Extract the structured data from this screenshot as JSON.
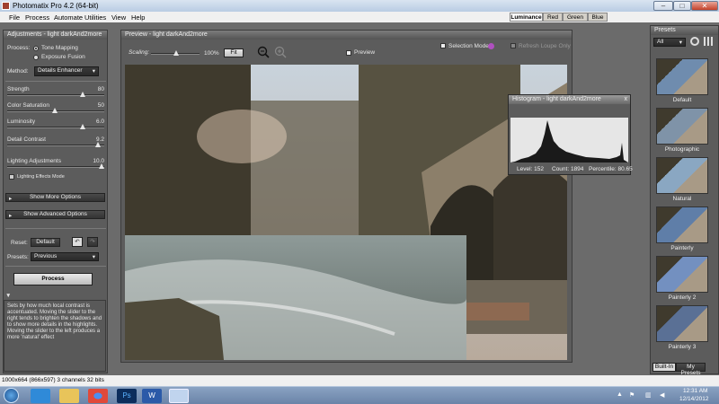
{
  "window": {
    "title": "Photomatix Pro 4.2 (64-bit)"
  },
  "menu": [
    "File",
    "Process",
    "Automate",
    "Utilities",
    "View",
    "Help"
  ],
  "adjustments": {
    "title": "Adjustments - light darkAnd2more",
    "process_label": "Process:",
    "opt_tone": "Tone Mapping",
    "opt_fusion": "Exposure Fusion",
    "method_label": "Method:",
    "method_value": "Details Enhancer",
    "sliders": [
      {
        "label": "Strength",
        "value": "80",
        "fraction": 0.8
      },
      {
        "label": "Color Saturation",
        "value": "50",
        "fraction": 0.5
      },
      {
        "label": "Luminosity",
        "value": "6.0",
        "fraction": 0.8
      },
      {
        "label": "Detail Contrast",
        "value": "9.2",
        "fraction": 0.96
      },
      {
        "label": "Lighting Adjustments",
        "value": "10.0",
        "fraction": 1.0
      }
    ],
    "lighting_effects": "Lighting Effects Mode",
    "show_more": "Show More Options",
    "show_advanced": "Show Advanced Options",
    "reset_label": "Reset:",
    "default_btn": "Default",
    "presets_label": "Presets:",
    "presets_value": "Previous",
    "process_btn": "Process",
    "help_text": "Sets by how much local contrast is accentuated. Moving the slider to the right tends to brighten the shadows and to show more details in the highlights. Moving the slider to the left produces a more 'natural' effect"
  },
  "preview": {
    "title": "Preview - light darkAnd2more",
    "scaling_label": "Scaling:",
    "scale_value": "100%",
    "fit_btn": "Fit",
    "preview_label": "Preview",
    "selection_mode": "Selection Mode",
    "refresh_label": "Refresh Loupe Only"
  },
  "histogram": {
    "title": "Histogram - light darkAnd2more",
    "tabs": [
      "Luminance",
      "Red",
      "Green",
      "Blue"
    ],
    "level": "Level: 152",
    "count": "Count: 1894",
    "percentile": "Percentile: 80.65"
  },
  "presets": {
    "title": "Presets",
    "filter": "All",
    "items": [
      "Default",
      "Photographic",
      "Natural",
      "Painterly",
      "Painterly 2",
      "Painterly 3"
    ],
    "tab_builtin": "Built-In",
    "tab_my": "My Presets"
  },
  "status": {
    "text": "1000x664 (866x597) 3 channels 32 bits"
  },
  "taskbar": {
    "time": "12:31 AM",
    "date": "12/14/2012"
  },
  "colors": {
    "panel": "#5c5c5c",
    "accent": "#b9cce3",
    "taskbar": "#6a84a8"
  }
}
